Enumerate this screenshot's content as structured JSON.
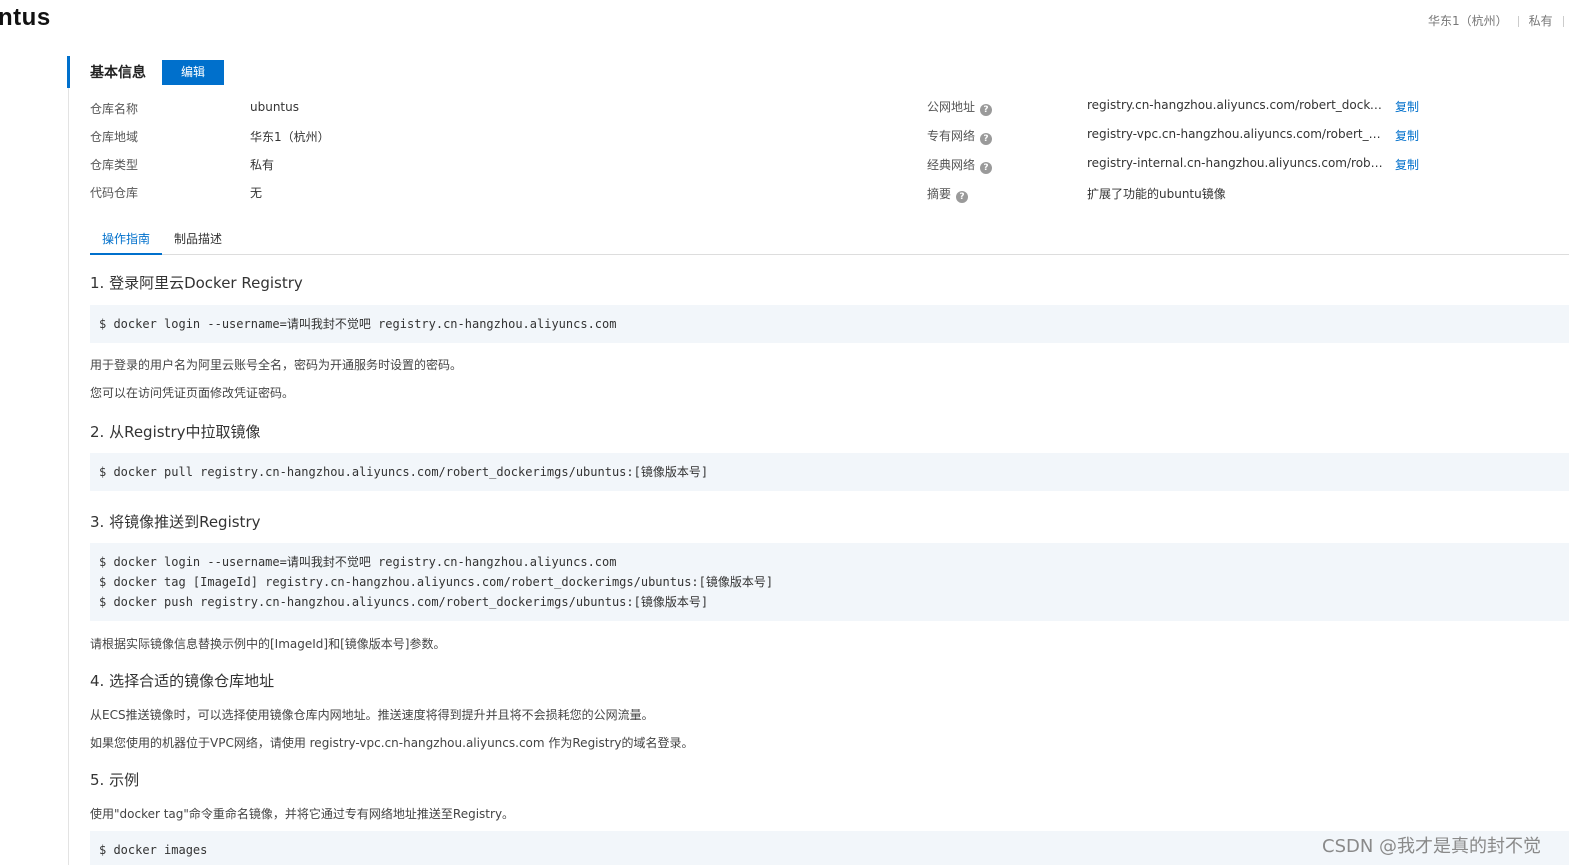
{
  "header": {
    "repo_title": "ntus",
    "region": "华东1（杭州）",
    "visibility": "私有"
  },
  "basic_info": {
    "section_title": "基本信息",
    "edit_label": "编辑",
    "left_fields": [
      {
        "label": "仓库名称",
        "value": "ubuntus"
      },
      {
        "label": "仓库地域",
        "value": "华东1（杭州）"
      },
      {
        "label": "仓库类型",
        "value": "私有"
      },
      {
        "label": "代码仓库",
        "value": "无"
      }
    ],
    "right_fields": [
      {
        "label": "公网地址",
        "value": "registry.cn-hangzhou.aliyuncs.com/robert_dockerimgs/...",
        "action": "复制"
      },
      {
        "label": "专有网络",
        "value": "registry-vpc.cn-hangzhou.aliyuncs.com/robert_dockeri...",
        "action": "复制"
      },
      {
        "label": "经典网络",
        "value": "registry-internal.cn-hangzhou.aliyuncs.com/robert_doc...",
        "action": "复制"
      },
      {
        "label": "摘要",
        "value": "扩展了功能的ubuntu镜像",
        "action": ""
      }
    ],
    "help_icon": "question-icon"
  },
  "tabs": [
    {
      "label": "操作指南",
      "active": true
    },
    {
      "label": "制品描述",
      "active": false
    }
  ],
  "guide": {
    "step1": {
      "heading": "1. 登录阿里云Docker Registry",
      "code": [
        "$ docker login --username=请叫我封不觉吧 registry.cn-hangzhou.aliyuncs.com"
      ],
      "notes": [
        "用于登录的用户名为阿里云账号全名，密码为开通服务时设置的密码。",
        "您可以在访问凭证页面修改凭证密码。"
      ]
    },
    "step2": {
      "heading": "2. 从Registry中拉取镜像",
      "code": [
        "$ docker pull registry.cn-hangzhou.aliyuncs.com/robert_dockerimgs/ubuntus:[镜像版本号]"
      ]
    },
    "step3": {
      "heading": "3. 将镜像推送到Registry",
      "code": [
        "$ docker login --username=请叫我封不觉吧 registry.cn-hangzhou.aliyuncs.com",
        "$ docker tag [ImageId] registry.cn-hangzhou.aliyuncs.com/robert_dockerimgs/ubuntus:[镜像版本号]",
        "$ docker push registry.cn-hangzhou.aliyuncs.com/robert_dockerimgs/ubuntus:[镜像版本号]"
      ],
      "notes": [
        "请根据实际镜像信息替换示例中的[ImageId]和[镜像版本号]参数。"
      ]
    },
    "step4": {
      "heading": "4. 选择合适的镜像仓库地址",
      "notes": [
        "从ECS推送镜像时，可以选择使用镜像仓库内网地址。推送速度将得到提升并且将不会损耗您的公网流量。",
        "如果您使用的机器位于VPC网络，请使用 registry-vpc.cn-hangzhou.aliyuncs.com 作为Registry的域名登录。"
      ]
    },
    "step5": {
      "heading": "5. 示例",
      "notes": [
        "使用\"docker tag\"命令重命名镜像，并将它通过专有网络地址推送至Registry。"
      ],
      "code": [
        "$ docker images"
      ]
    }
  },
  "watermark": "CSDN @我才是真的封不觉"
}
